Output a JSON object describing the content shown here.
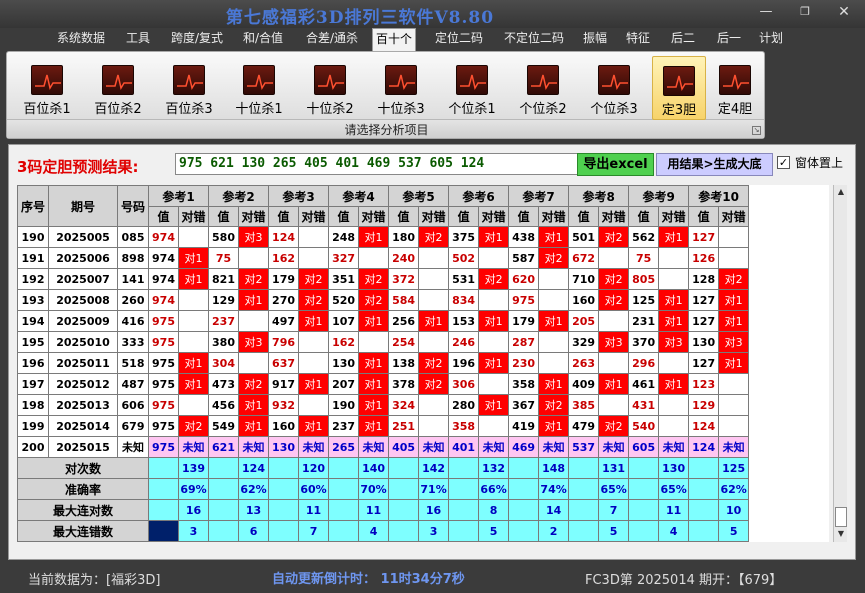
{
  "app": {
    "title": "第七感福彩3D排列三软件V8.80"
  },
  "menu": [
    "系统数据",
    "工具",
    "跨度/复式",
    "和/合值",
    "合差/通杀",
    "百十个",
    "定位二码",
    "不定位二码",
    "振幅",
    "特征",
    "后二",
    "后一",
    "计划"
  ],
  "active_menu": 5,
  "ribbon": {
    "buttons": [
      "百位杀1",
      "百位杀2",
      "百位杀3",
      "十位杀1",
      "十位杀2",
      "十位杀3",
      "个位杀1",
      "个位杀2",
      "个位杀3",
      "定3胆",
      "定4胆"
    ],
    "selected": 9,
    "group_label": "请选择分析项目"
  },
  "prediction": {
    "label": "3码定胆预测结果:",
    "value": "975 621 130 265 405 401 469 537 605 124",
    "export_button": "导出excel",
    "generate_button": "用结果>生成大底",
    "topmost_label": "窗体置上",
    "topmost_checked": true
  },
  "table": {
    "col_seq": "序号",
    "col_issue": "期号",
    "col_code": "号码",
    "refs": [
      "参考1",
      "参考2",
      "参考3",
      "参考4",
      "参考5",
      "参考6",
      "参考7",
      "参考8",
      "参考9",
      "参考10"
    ],
    "sub_value": "值",
    "sub_result": "对错",
    "rows": [
      {
        "seq": "190",
        "issue": "2025005",
        "code": "085",
        "cells": [
          [
            "974",
            "",
            0
          ],
          [
            "580",
            "对3",
            1
          ],
          [
            "124",
            "",
            0
          ],
          [
            "248",
            "对1",
            1
          ],
          [
            "180",
            "对2",
            1
          ],
          [
            "375",
            "对1",
            1
          ],
          [
            "438",
            "对1",
            1
          ],
          [
            "501",
            "对2",
            1
          ],
          [
            "562",
            "对1",
            1
          ],
          [
            "127",
            "",
            0
          ]
        ]
      },
      {
        "seq": "191",
        "issue": "2025006",
        "code": "898",
        "cells": [
          [
            "974",
            "对1",
            1
          ],
          [
            "75",
            "",
            0
          ],
          [
            "162",
            "",
            0
          ],
          [
            "327",
            "",
            0
          ],
          [
            "240",
            "",
            0
          ],
          [
            "502",
            "",
            0
          ],
          [
            "587",
            "对2",
            1
          ],
          [
            "672",
            "",
            0
          ],
          [
            "75",
            "",
            0
          ],
          [
            "126",
            "",
            0
          ]
        ]
      },
      {
        "seq": "192",
        "issue": "2025007",
        "code": "141",
        "cells": [
          [
            "974",
            "对1",
            1
          ],
          [
            "821",
            "对2",
            1
          ],
          [
            "179",
            "对2",
            1
          ],
          [
            "351",
            "对2",
            1
          ],
          [
            "372",
            "",
            0
          ],
          [
            "531",
            "对2",
            1
          ],
          [
            "620",
            "",
            0
          ],
          [
            "710",
            "对2",
            1
          ],
          [
            "805",
            "",
            0
          ],
          [
            "128",
            "对2",
            1
          ]
        ]
      },
      {
        "seq": "193",
        "issue": "2025008",
        "code": "260",
        "cells": [
          [
            "974",
            "",
            0
          ],
          [
            "129",
            "对1",
            1
          ],
          [
            "270",
            "对2",
            1
          ],
          [
            "520",
            "对2",
            1
          ],
          [
            "584",
            "",
            0
          ],
          [
            "834",
            "",
            0
          ],
          [
            "975",
            "",
            0
          ],
          [
            "160",
            "对2",
            1
          ],
          [
            "125",
            "对1",
            1
          ],
          [
            "127",
            "对1",
            1
          ]
        ]
      },
      {
        "seq": "194",
        "issue": "2025009",
        "code": "416",
        "cells": [
          [
            "975",
            "",
            0
          ],
          [
            "237",
            "",
            0
          ],
          [
            "497",
            "对1",
            1
          ],
          [
            "107",
            "对1",
            1
          ],
          [
            "256",
            "对1",
            1
          ],
          [
            "153",
            "对1",
            1
          ],
          [
            "179",
            "对1",
            1
          ],
          [
            "205",
            "",
            0
          ],
          [
            "231",
            "对1",
            1
          ],
          [
            "127",
            "对1",
            1
          ]
        ]
      },
      {
        "seq": "195",
        "issue": "2025010",
        "code": "333",
        "cells": [
          [
            "975",
            "",
            0
          ],
          [
            "380",
            "对3",
            1
          ],
          [
            "796",
            "",
            0
          ],
          [
            "162",
            "",
            0
          ],
          [
            "254",
            "",
            0
          ],
          [
            "246",
            "",
            0
          ],
          [
            "287",
            "",
            0
          ],
          [
            "329",
            "对3",
            1
          ],
          [
            "370",
            "对3",
            1
          ],
          [
            "130",
            "对3",
            1
          ]
        ]
      },
      {
        "seq": "196",
        "issue": "2025011",
        "code": "518",
        "cells": [
          [
            "975",
            "对1",
            1
          ],
          [
            "304",
            "",
            0
          ],
          [
            "637",
            "",
            0
          ],
          [
            "130",
            "对1",
            1
          ],
          [
            "138",
            "对2",
            1
          ],
          [
            "196",
            "对1",
            1
          ],
          [
            "230",
            "",
            0
          ],
          [
            "263",
            "",
            0
          ],
          [
            "296",
            "",
            0
          ],
          [
            "127",
            "对1",
            1
          ]
        ]
      },
      {
        "seq": "197",
        "issue": "2025012",
        "code": "487",
        "cells": [
          [
            "975",
            "对1",
            1
          ],
          [
            "473",
            "对2",
            1
          ],
          [
            "917",
            "对1",
            1
          ],
          [
            "207",
            "对1",
            1
          ],
          [
            "378",
            "对2",
            1
          ],
          [
            "306",
            "",
            0
          ],
          [
            "358",
            "对1",
            1
          ],
          [
            "409",
            "对1",
            1
          ],
          [
            "461",
            "对1",
            1
          ],
          [
            "123",
            "",
            0
          ]
        ]
      },
      {
        "seq": "198",
        "issue": "2025013",
        "code": "606",
        "cells": [
          [
            "975",
            "",
            0
          ],
          [
            "456",
            "对1",
            1
          ],
          [
            "932",
            "",
            0
          ],
          [
            "190",
            "对1",
            1
          ],
          [
            "324",
            "",
            0
          ],
          [
            "280",
            "对1",
            1
          ],
          [
            "367",
            "对2",
            1
          ],
          [
            "385",
            "",
            0
          ],
          [
            "431",
            "",
            0
          ],
          [
            "129",
            "",
            0
          ]
        ]
      },
      {
        "seq": "199",
        "issue": "2025014",
        "code": "679",
        "cells": [
          [
            "975",
            "对2",
            1
          ],
          [
            "549",
            "对1",
            1
          ],
          [
            "160",
            "对1",
            1
          ],
          [
            "237",
            "对1",
            1
          ],
          [
            "251",
            "",
            0
          ],
          [
            "358",
            "",
            0
          ],
          [
            "419",
            "对1",
            1
          ],
          [
            "479",
            "对2",
            1
          ],
          [
            "540",
            "",
            0
          ],
          [
            "124",
            "",
            0
          ]
        ]
      }
    ],
    "last_row": {
      "seq": "200",
      "issue": "2025015",
      "code": "未知",
      "values": [
        "975",
        "621",
        "130",
        "265",
        "405",
        "401",
        "469",
        "537",
        "605",
        "124"
      ],
      "unknown": "未知"
    },
    "stats": [
      {
        "label": "对次数",
        "values": [
          "139",
          "124",
          "120",
          "140",
          "142",
          "132",
          "148",
          "131",
          "130",
          "125"
        ]
      },
      {
        "label": "准确率",
        "values": [
          "69%",
          "62%",
          "60%",
          "70%",
          "71%",
          "66%",
          "74%",
          "65%",
          "65%",
          "62%"
        ]
      },
      {
        "label": "最大连对数",
        "values": [
          "16",
          "13",
          "11",
          "11",
          "16",
          "8",
          "14",
          "7",
          "11",
          "10"
        ]
      },
      {
        "label": "最大连错数",
        "values": [
          "3",
          "6",
          "7",
          "4",
          "3",
          "5",
          "2",
          "5",
          "4",
          "5"
        ]
      }
    ]
  },
  "status": {
    "current": "当前数据为：[福彩3D]",
    "countdown": "自动更新倒计时：   11时34分7秒",
    "issue": "FC3D第 2025014 期开：【679】"
  }
}
